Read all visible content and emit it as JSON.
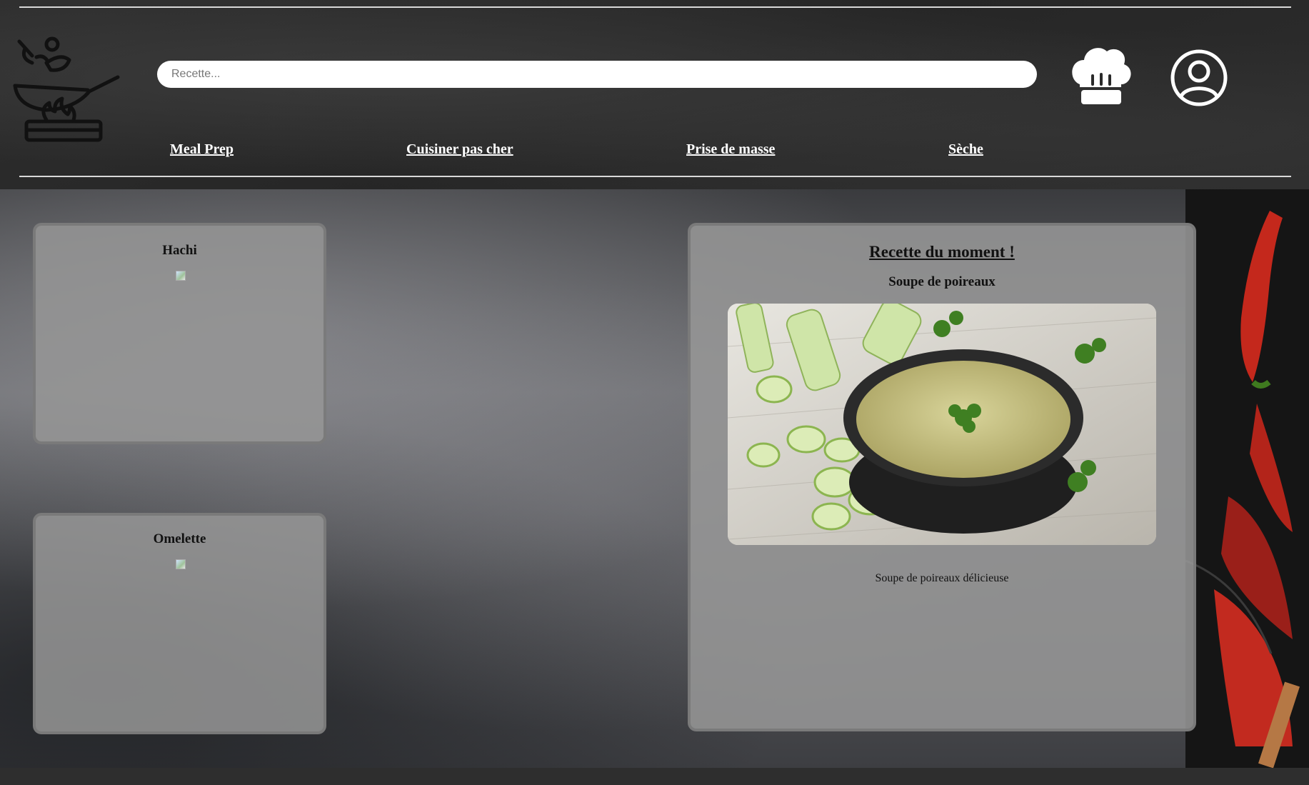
{
  "header": {
    "search_placeholder": "Recette...",
    "nav": [
      "Meal Prep",
      "Cuisiner pas cher",
      "Prise de masse",
      "Sèche"
    ]
  },
  "recipes": [
    {
      "title": "Hachi"
    },
    {
      "title": "Omelette"
    }
  ],
  "featured": {
    "heading": "Recette du moment !",
    "name": "Soupe de poireaux",
    "description": "Soupe de poireaux délicieuse"
  },
  "icons": {
    "logo": "chef-wok-logo-icon",
    "chef": "chef-hat-icon",
    "user": "user-account-icon"
  },
  "colors": {
    "header_bg": "#2b2b2b",
    "rule": "#d9d9d9",
    "card_bg": "#969696"
  }
}
